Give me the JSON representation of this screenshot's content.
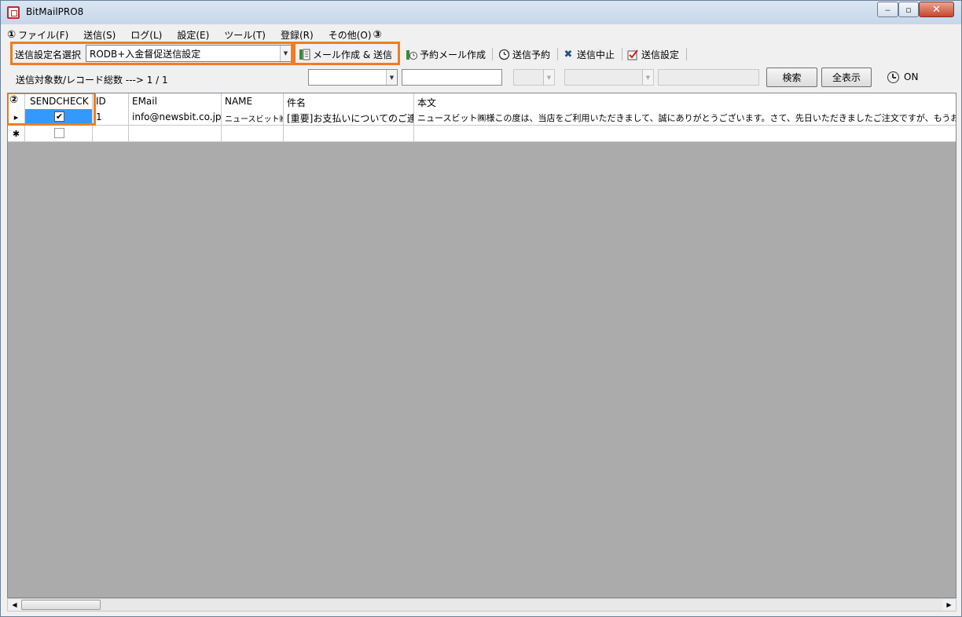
{
  "window": {
    "title": "BitMailPRO8",
    "minimize": "‒",
    "maximize": "▫",
    "close": "✕"
  },
  "markers": {
    "one": "①",
    "two": "②",
    "three": "③"
  },
  "menu": {
    "items": [
      "ファイル(F)",
      "送信(S)",
      "ログ(L)",
      "設定(E)",
      "ツール(T)",
      "登録(R)",
      "その他(O)"
    ]
  },
  "toolbar": {
    "profile_label": "送信設定名選択",
    "profile_value": "RODB+入金督促送信設定",
    "compose_send": "メール作成 & 送信",
    "scheduled_compose": "予約メール作成",
    "schedule_send": "送信予約",
    "stop_send": "送信中止",
    "send_settings": "送信設定"
  },
  "filter": {
    "count_text": "送信対象数/レコード総数 ---> 1 / 1",
    "search_button": "検索",
    "show_all_button": "全表示",
    "schedule_status": "ON"
  },
  "grid": {
    "columns": [
      "SENDCHECK",
      "ID",
      "EMail",
      "NAME",
      "件名",
      "本文"
    ],
    "rows": [
      {
        "marker": "▸",
        "checked": "✔",
        "id": "1",
        "email": "info@newsbit.co.jp",
        "name": "ニュースビット㈱",
        "subject": "[重要]お支払いについてのご連絡",
        "body": "ニュースビット㈱様この度は、当店をご利用いただきまして、誠にありがとうございます。さて、先日いただきましたご注文ですが、もうお振込はお済みでしょうか？"
      }
    ],
    "new_row_marker": "✱"
  },
  "scrollbar": {
    "left": "◀",
    "right": "▶"
  },
  "colors": {
    "highlight": "#ef7d22",
    "selection": "#3399ff"
  }
}
